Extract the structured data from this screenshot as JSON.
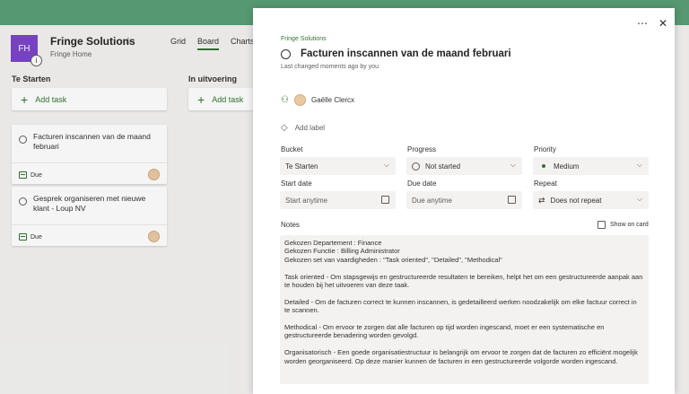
{
  "board": {
    "plan_avatar": "FH",
    "plan_title": "Fringe Solutions",
    "plan_subtitle": "Fringe Home",
    "views": [
      "Grid",
      "Board",
      "Charts"
    ],
    "active_view": "Board",
    "buckets": [
      {
        "title": "Te Starten",
        "add_label": "Add task"
      },
      {
        "title": "In uitvoering",
        "add_label": "Add task"
      }
    ],
    "cards": [
      {
        "title": "Facturen inscannen van de maand februari",
        "due": "Due"
      },
      {
        "title": "Gesprek organiseren met nieuwe klant - Loup NV",
        "due": "Due"
      }
    ]
  },
  "panel": {
    "more_icon": "ellipsis-icon",
    "close_icon": "close-icon",
    "breadcrumb": "Fringe Solutions",
    "task_title": "Facturen inscannen van de maand februari",
    "last_changed": "Last changed moments ago by you",
    "assignee": "Gaëlle Clercx",
    "add_label": "Add label",
    "fields": {
      "bucket": {
        "label": "Bucket",
        "value": "Te Starten"
      },
      "progress": {
        "label": "Progress",
        "value": "Not started"
      },
      "priority": {
        "label": "Priority",
        "value": "Medium"
      },
      "start_date": {
        "label": "Start date",
        "placeholder": "Start anytime"
      },
      "due_date": {
        "label": "Due date",
        "placeholder": "Due anytime"
      },
      "repeat": {
        "label": "Repeat",
        "value": "Does not repeat"
      }
    },
    "notes_label": "Notes",
    "show_on_card": "Show on card",
    "notes": "Gekozen Departement : Finance\nGekozen Functie : Billing Administrator\nGekozen set van vaardigheden : \"Task oriented\", \"Detailed\", \"Methodical\"\n\nTask oriented - Om stapsgewijs en gestructureerde resultaten te bereiken, helpt het om een gestructureerde aanpak aan te houden bij het uitvoeren van deze taak.\n\nDetailed - Om de facturen correct te kunnen inscannen, is gedetailleerd werken noodzakelijk om elke factuur correct in te scannen.\n\nMethodical - Om ervoor te zorgen dat alle facturen op tijd worden ingescand, moet er een systematische en gestructureerde benadering worden gevolgd.\n\nOrganisatorisch - Een goede organisatiestructuur is belangrijk om ervoor te zorgen dat de facturen zo efficiënt mogelijk worden georganiseerd. Op deze manier kunnen de facturen in een gestructureerde volgorde worden ingescand."
  },
  "colors": {
    "topbar": "#5a9f76",
    "accent": "#31752f",
    "plan_avatar": "#7b45c9"
  }
}
